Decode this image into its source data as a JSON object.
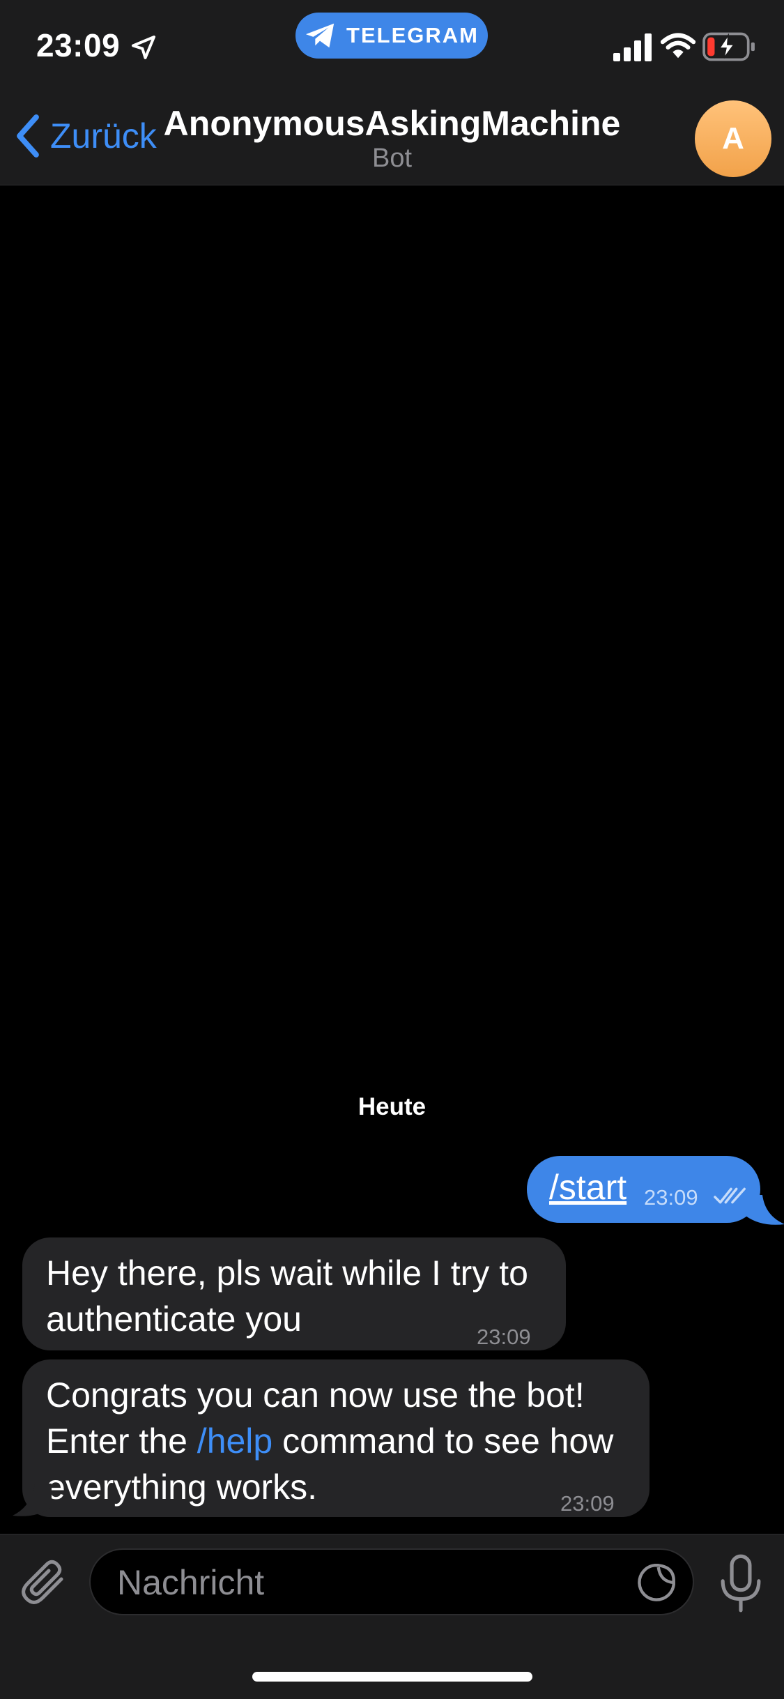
{
  "status_bar": {
    "time": "23:09",
    "return_pill_label": "TELEGRAM",
    "icons": [
      "location-arrow-icon",
      "telegram-icon",
      "cellular-signal-icon",
      "wifi-icon",
      "battery-charging-icon"
    ]
  },
  "nav": {
    "back_label": "Zurück",
    "title": "AnonymousAskingMachine",
    "subtitle": "Bot",
    "avatar_letter": "A"
  },
  "chat": {
    "date_label": "Heute",
    "messages": [
      {
        "direction": "outgoing",
        "text": "/start",
        "time": "23:09",
        "status": "read"
      },
      {
        "direction": "incoming",
        "lines": [
          "Hey there, pls wait while I try to",
          "authenticate you"
        ],
        "time": "23:09"
      },
      {
        "direction": "incoming",
        "lines": [
          "Congrats you can now use the bot!",
          "Enter the ",
          "/help",
          " command to see how",
          "everything works."
        ],
        "time": "23:09"
      }
    ]
  },
  "input": {
    "placeholder": "Nachricht",
    "value": ""
  },
  "colors": {
    "accent": "#3e86e8",
    "link": "#3e8ef7",
    "bar_bg": "#1c1c1d",
    "bubble_in": "#252527",
    "avatar": "#f5b462",
    "battery_low": "#ff3b30"
  }
}
